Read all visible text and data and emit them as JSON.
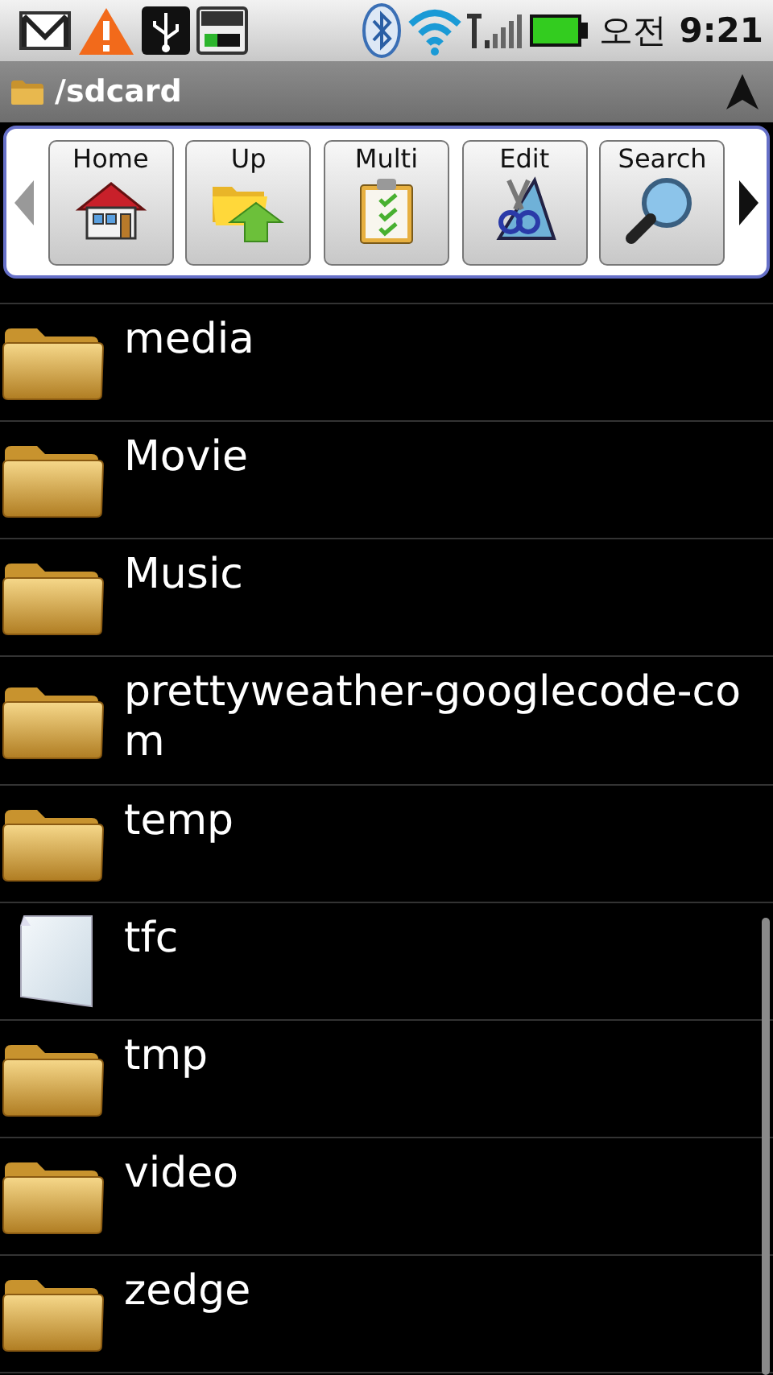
{
  "status_bar": {
    "clock_period": "오전",
    "clock_time": "9:21"
  },
  "title_bar": {
    "path": "/sdcard"
  },
  "toolbar": {
    "buttons": [
      {
        "label": "Home",
        "kind": "home"
      },
      {
        "label": "Up",
        "kind": "up"
      },
      {
        "label": "Multi",
        "kind": "multi"
      },
      {
        "label": "Edit",
        "kind": "edit"
      },
      {
        "label": "Search",
        "kind": "search"
      }
    ]
  },
  "files": [
    {
      "name": "media",
      "kind": "folder"
    },
    {
      "name": "Movie",
      "kind": "folder"
    },
    {
      "name": "Music",
      "kind": "folder"
    },
    {
      "name": "prettyweather-googlecode-com",
      "kind": "folder"
    },
    {
      "name": "temp",
      "kind": "folder"
    },
    {
      "name": "tfc",
      "kind": "file"
    },
    {
      "name": "tmp",
      "kind": "folder"
    },
    {
      "name": "video",
      "kind": "folder"
    },
    {
      "name": "zedge",
      "kind": "folder"
    }
  ]
}
